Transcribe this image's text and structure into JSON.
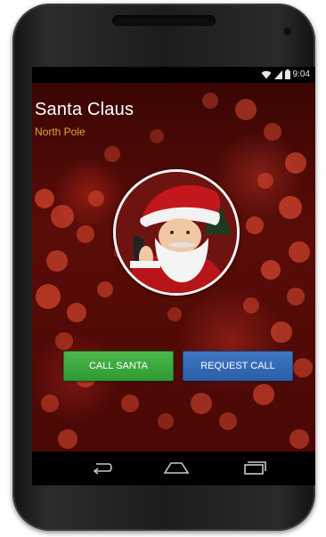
{
  "status_bar": {
    "time": "9:04",
    "icons": [
      "wifi-icon",
      "cell-signal-icon",
      "battery-icon"
    ]
  },
  "contact": {
    "name": "Santa Claus",
    "location": "North Pole"
  },
  "actions": {
    "call_label": "CALL SANTA",
    "request_label": "REQUEST CALL"
  },
  "nav_bar": {
    "icons": [
      "back-icon",
      "home-icon",
      "recent-apps-icon"
    ]
  },
  "colors": {
    "location_text": "#e8a33a",
    "call_button": "#3aa83c",
    "request_button": "#3168b4",
    "background": "#4a0806"
  }
}
